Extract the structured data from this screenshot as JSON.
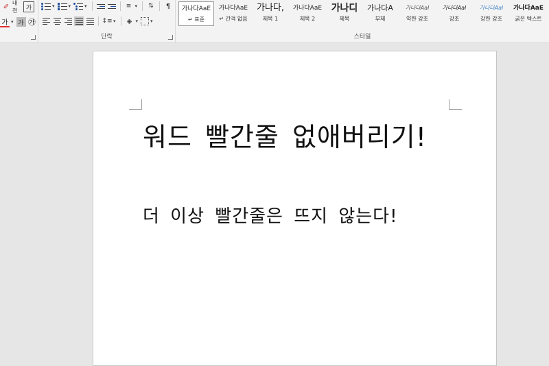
{
  "ribbon": {
    "font_group": {
      "icons": {
        "row1": [
          "eraser-icon",
          "phonetic-guide-icon",
          "enclosed-character-icon"
        ],
        "row2": [
          "font-color-icon",
          "character-shading-icon",
          "enclose-characters-icon"
        ]
      },
      "row1_text": {
        "phonetic": "내천",
        "enclosed": "가"
      },
      "row2_text": {
        "font_color": "가",
        "shading": "가",
        "enclose": "㉮"
      },
      "font_color": "#e03030"
    },
    "paragraph_group": {
      "label": "단락"
    },
    "styles_group": {
      "label": "스타일",
      "items": [
        {
          "sample": "가나다AaE",
          "name": "↵ 표준",
          "selected": true
        },
        {
          "sample": "가나다AaE",
          "name": "↵ 간격 없음",
          "selected": false
        },
        {
          "sample": "가나다,",
          "name": "제목 1",
          "selected": false
        },
        {
          "sample": "가나다AaE",
          "name": "제목 2",
          "selected": false
        },
        {
          "sample": "가나디",
          "name": "제목",
          "selected": false
        },
        {
          "sample": "가나다A",
          "name": "부제",
          "selected": false
        },
        {
          "sample": "가나다AaI",
          "name": "약한 강조",
          "selected": false
        },
        {
          "sample": "가나다AaI",
          "name": "강조",
          "selected": false
        },
        {
          "sample": "가나다AaI",
          "name": "강한 강조",
          "selected": false
        },
        {
          "sample": "가나다AaE",
          "name": "굵은 텍스트",
          "selected": false
        }
      ]
    }
  },
  "document": {
    "heading": "워드 빨간줄 없애버리기!",
    "body": "더 이상 빨간줄은 뜨지 않는다!"
  },
  "colors": {
    "ribbon_bg": "#f3f3f3",
    "canvas_bg": "#e6e6e6",
    "page_bg": "#ffffff",
    "accent_blue": "#1f4e9b",
    "font_color_red": "#e03030"
  }
}
